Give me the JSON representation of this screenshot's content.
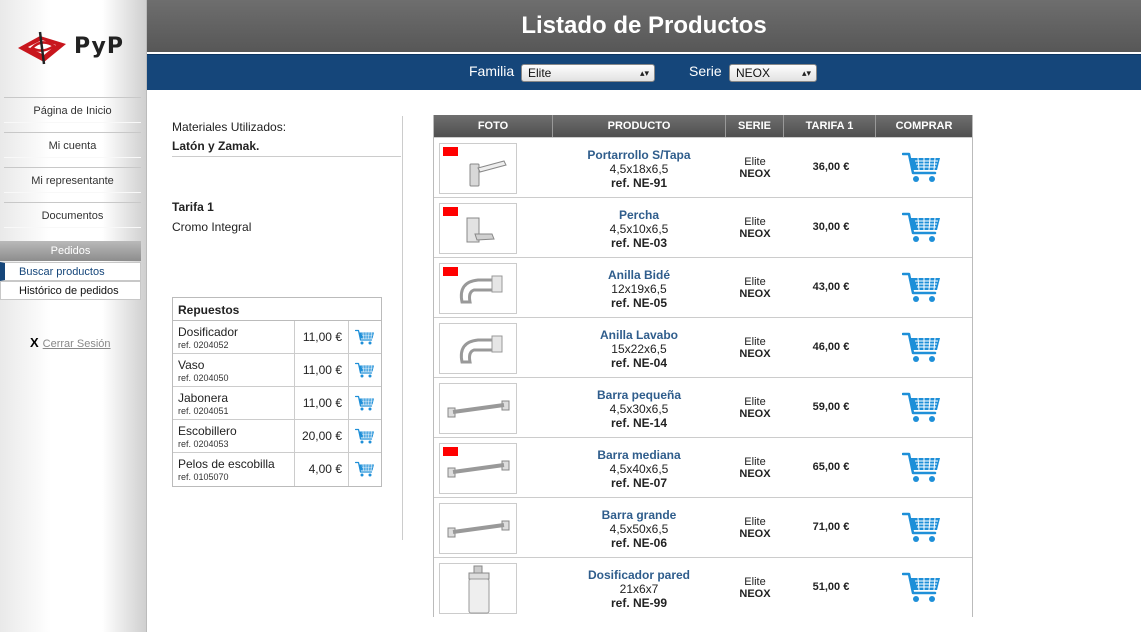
{
  "brand": {
    "name": "PyP"
  },
  "header": {
    "title": "Listado de Productos"
  },
  "filters": {
    "familia_label": "Familia",
    "familia_value": "Elite",
    "serie_label": "Serie",
    "serie_value": "NEOX"
  },
  "sidebar": {
    "items": [
      {
        "label": "Página de Inicio"
      },
      {
        "label": "Mi cuenta"
      },
      {
        "label": "Mi representante"
      },
      {
        "label": "Documentos"
      }
    ],
    "section": "Pedidos",
    "subitems": [
      {
        "label": "Buscar productos",
        "active": true
      },
      {
        "label": "Histórico de pedidos",
        "active": false
      }
    ],
    "logout": "Cerrar Sesión"
  },
  "info": {
    "materiales_label": "Materiales Utilizados:",
    "materiales_value": "Latón y Zamak.",
    "tarifa_label": "Tarifa 1",
    "acabado": "Cromo Integral"
  },
  "repuestos": {
    "title": "Repuestos",
    "rows": [
      {
        "name": "Dosificador",
        "ref": "ref. 0204052",
        "price": "11,00 €"
      },
      {
        "name": "Vaso",
        "ref": "ref. 0204050",
        "price": "11,00 €"
      },
      {
        "name": "Jabonera",
        "ref": "ref. 0204051",
        "price": "11,00 €"
      },
      {
        "name": "Escobillero",
        "ref": "ref. 0204053",
        "price": "20,00 €"
      },
      {
        "name": "Pelos de escobilla",
        "ref": "ref. 0105070",
        "price": "4,00 €"
      }
    ]
  },
  "table": {
    "headers": [
      "FOTO",
      "PRODUCTO",
      "SERIE",
      "TARIFA 1",
      "COMPRAR"
    ],
    "rows": [
      {
        "name": "Portarrollo S/Tapa",
        "dims": "4,5x18x6,5",
        "ref": "ref. NE-91",
        "familia": "Elite",
        "serie": "NEOX",
        "price": "36,00 €",
        "flag": true,
        "img": "tp"
      },
      {
        "name": "Percha",
        "dims": "4,5x10x6,5",
        "ref": "ref. NE-03",
        "familia": "Elite",
        "serie": "NEOX",
        "price": "30,00 €",
        "flag": true,
        "img": "hook"
      },
      {
        "name": "Anilla Bidé",
        "dims": "12x19x6,5",
        "ref": "ref. NE-05",
        "familia": "Elite",
        "serie": "NEOX",
        "price": "43,00 €",
        "flag": true,
        "img": "ring"
      },
      {
        "name": "Anilla Lavabo",
        "dims": "15x22x6,5",
        "ref": "ref. NE-04",
        "familia": "Elite",
        "serie": "NEOX",
        "price": "46,00 €",
        "flag": false,
        "img": "ring"
      },
      {
        "name": "Barra pequeña",
        "dims": "4,5x30x6,5",
        "ref": "ref. NE-14",
        "familia": "Elite",
        "serie": "NEOX",
        "price": "59,00 €",
        "flag": false,
        "img": "bar"
      },
      {
        "name": "Barra mediana",
        "dims": "4,5x40x6,5",
        "ref": "ref. NE-07",
        "familia": "Elite",
        "serie": "NEOX",
        "price": "65,00 €",
        "flag": true,
        "img": "bar"
      },
      {
        "name": "Barra grande",
        "dims": "4,5x50x6,5",
        "ref": "ref. NE-06",
        "familia": "Elite",
        "serie": "NEOX",
        "price": "71,00 €",
        "flag": false,
        "img": "bar"
      },
      {
        "name": "Dosificador pared",
        "dims": "21x6x7",
        "ref": "ref. NE-99",
        "familia": "Elite",
        "serie": "NEOX",
        "price": "51,00 €",
        "flag": false,
        "img": "dispenser"
      }
    ]
  },
  "colors": {
    "nav_blue": "#15467a",
    "header_gray": "#5f5f5f",
    "link_blue": "#2f5d8c",
    "cart_blue": "#1e8fd8",
    "flag_red": "#ff0000"
  }
}
